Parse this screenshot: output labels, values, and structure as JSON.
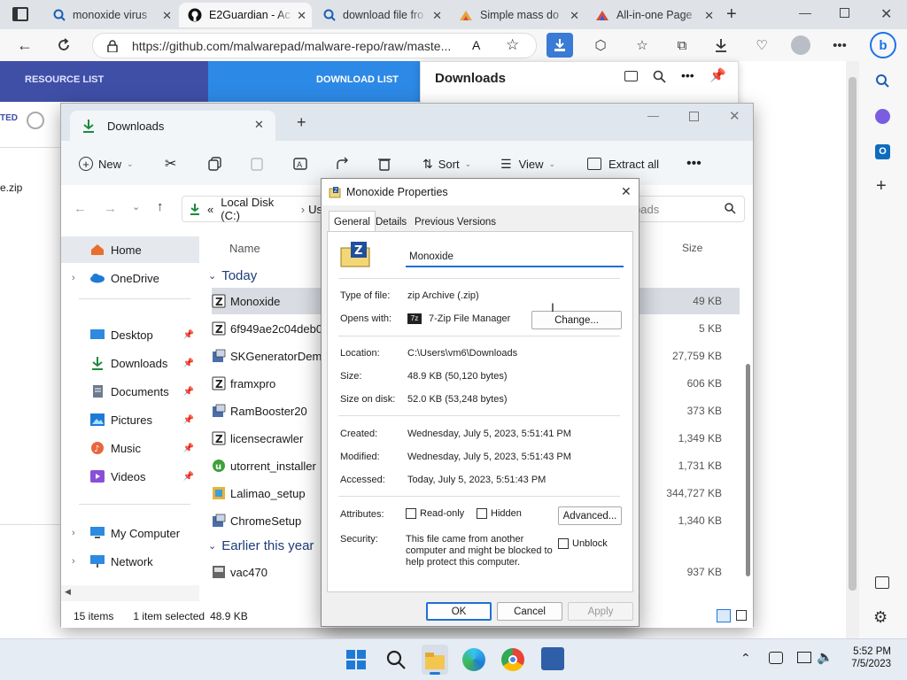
{
  "browser": {
    "tabs": [
      {
        "title": "monoxide virus"
      },
      {
        "title": "E2Guardian - Ac"
      },
      {
        "title": "download file fro"
      },
      {
        "title": "Simple mass do"
      },
      {
        "title": "All-in-one Page"
      }
    ],
    "url": "https://github.com/malwarepad/malware-repo/raw/maste..."
  },
  "site": {
    "nav_resource": "RESOURCE LIST",
    "nav_download": "DOWNLOAD LIST",
    "left_fragment_1": "TED",
    "left_fragment_2": "e.zip"
  },
  "downloads_flyout": {
    "title": "Downloads"
  },
  "explorer": {
    "tab_title": "Downloads",
    "cmd": {
      "new": "New",
      "sort": "Sort",
      "view": "View",
      "extract": "Extract all"
    },
    "address": {
      "prefix": "«",
      "path": "Local Disk (C:)",
      "next": "Us"
    },
    "search_placeholder": "oads",
    "columns": {
      "name": "Name",
      "size": "Size"
    },
    "nav": {
      "home": "Home",
      "onedrive": "OneDrive",
      "desktop": "Desktop",
      "downloads": "Downloads",
      "documents": "Documents",
      "pictures": "Pictures",
      "music": "Music",
      "videos": "Videos",
      "mycomputer": "My Computer",
      "network": "Network"
    },
    "groups": {
      "today": "Today",
      "earlier": "Earlier this year"
    },
    "files": [
      {
        "name": "Monoxide",
        "size": "49 KB"
      },
      {
        "name": "6f949ae2c04deb08",
        "size": "5 KB"
      },
      {
        "name": "SKGeneratorDemo",
        "size": "27,759 KB"
      },
      {
        "name": "framxpro",
        "size": "606 KB"
      },
      {
        "name": "RamBooster20",
        "size": "373 KB"
      },
      {
        "name": "licensecrawler",
        "size": "1,349 KB"
      },
      {
        "name": "utorrent_installer",
        "size": "1,731 KB"
      },
      {
        "name": "Lalimao_setup",
        "size": "344,727 KB"
      },
      {
        "name": "ChromeSetup",
        "size": "1,340 KB"
      }
    ],
    "earlier_files": [
      {
        "name": "vac470",
        "size": "937 KB"
      }
    ],
    "status": {
      "items": "15 items",
      "selected": "1 item selected",
      "size": "48.9 KB"
    }
  },
  "properties": {
    "title": "Monoxide Properties",
    "tabs": {
      "general": "General",
      "details": "Details",
      "previous": "Previous Versions"
    },
    "filename": "Monoxide",
    "labels": {
      "type": "Type of file:",
      "opens": "Opens with:",
      "location": "Location:",
      "size": "Size:",
      "size_disk": "Size on disk:",
      "created": "Created:",
      "modified": "Modified:",
      "accessed": "Accessed:",
      "attributes": "Attributes:",
      "security": "Security:"
    },
    "values": {
      "type": "zip Archive (.zip)",
      "opens": "7-Zip File Manager",
      "location": "C:\\Users\\vm6\\Downloads",
      "size": "48.9 KB (50,120 bytes)",
      "size_disk": "52.0 KB (53,248 bytes)",
      "created": "Wednesday, July 5, 2023, 5:51:41 PM",
      "modified": "Wednesday, July 5, 2023, 5:51:43 PM",
      "accessed": "Today, July 5, 2023, 5:51:43 PM",
      "security_1": "This file came from another",
      "security_2": "computer and might be blocked to",
      "security_3": "help protect this computer."
    },
    "buttons": {
      "change": "Change...",
      "advanced": "Advanced...",
      "ok": "OK",
      "cancel": "Cancel",
      "apply": "Apply"
    },
    "checkboxes": {
      "readonly": "Read-only",
      "hidden": "Hidden",
      "unblock": "Unblock"
    }
  },
  "taskbar": {
    "time": "5:52 PM",
    "date": "7/5/2023"
  }
}
